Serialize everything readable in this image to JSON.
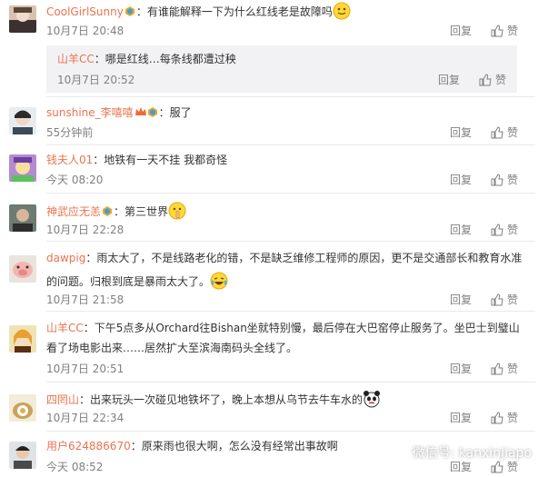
{
  "comments": [
    {
      "user": "CoolGirlSunny",
      "text": "：有谁能解释一下为什么红线老是故障吗",
      "time": "10月7日 20:48",
      "reply": "回复",
      "like": "赞"
    },
    {
      "user": "sunshine_李嘻嘻",
      "text": "：服了",
      "time": "55分钟前",
      "reply": "回复",
      "like": "赞"
    },
    {
      "user": "钱夫人01",
      "text": "：地铁有一天不挂 我都奇怪",
      "time": "今天 08:20",
      "reply": "回复",
      "like": "赞"
    },
    {
      "user": "神武应无恙",
      "text": "：第三世界",
      "time": "10月7日 22:28",
      "reply": "回复",
      "like": "赞"
    },
    {
      "user": "dawpig",
      "text_l1": "：雨太大了，不是线路老化的错，不是缺乏维修工程师的原因，更不是交通部长和教育水准",
      "text_l2": "的问题。归根到底是暴雨太大了。",
      "time": "10月7日 21:58",
      "reply": "回复",
      "like": "赞"
    },
    {
      "user": "山羊CC",
      "text_l1": "：下午5点多从Orchard往Bishan坐就特别慢，最后停在大巴窑停止服务了。坐巴士到璧山",
      "text_l2": "看了场电影出来……居然扩大至滨海南码头全线了。",
      "time": "10月7日 20:51",
      "reply": "回复",
      "like": "赞"
    },
    {
      "user": "四罔山",
      "text": "：出来玩头一次碰见地铁坏了，晚上本想从乌节去牛车水的",
      "time": "10月7日 22:34",
      "reply": "回复",
      "like": "赞"
    },
    {
      "user": "用户624886670",
      "text": "：原来雨也很大啊，怎么没有经常出事故啊",
      "time": "今天 08:52",
      "reply": "回复",
      "like": "赞"
    }
  ],
  "sub_reply": {
    "user": "山羊CC",
    "text": "：哪是红线…每条线都遭过秧",
    "time": "10月7日 20:52",
    "reply": "回复",
    "like": "赞"
  },
  "watermark": "微信号: kanxinjiapo",
  "colors": {
    "username": "#eb7350",
    "meta": "#808080",
    "subreply_bg": "#f2f2f5"
  }
}
